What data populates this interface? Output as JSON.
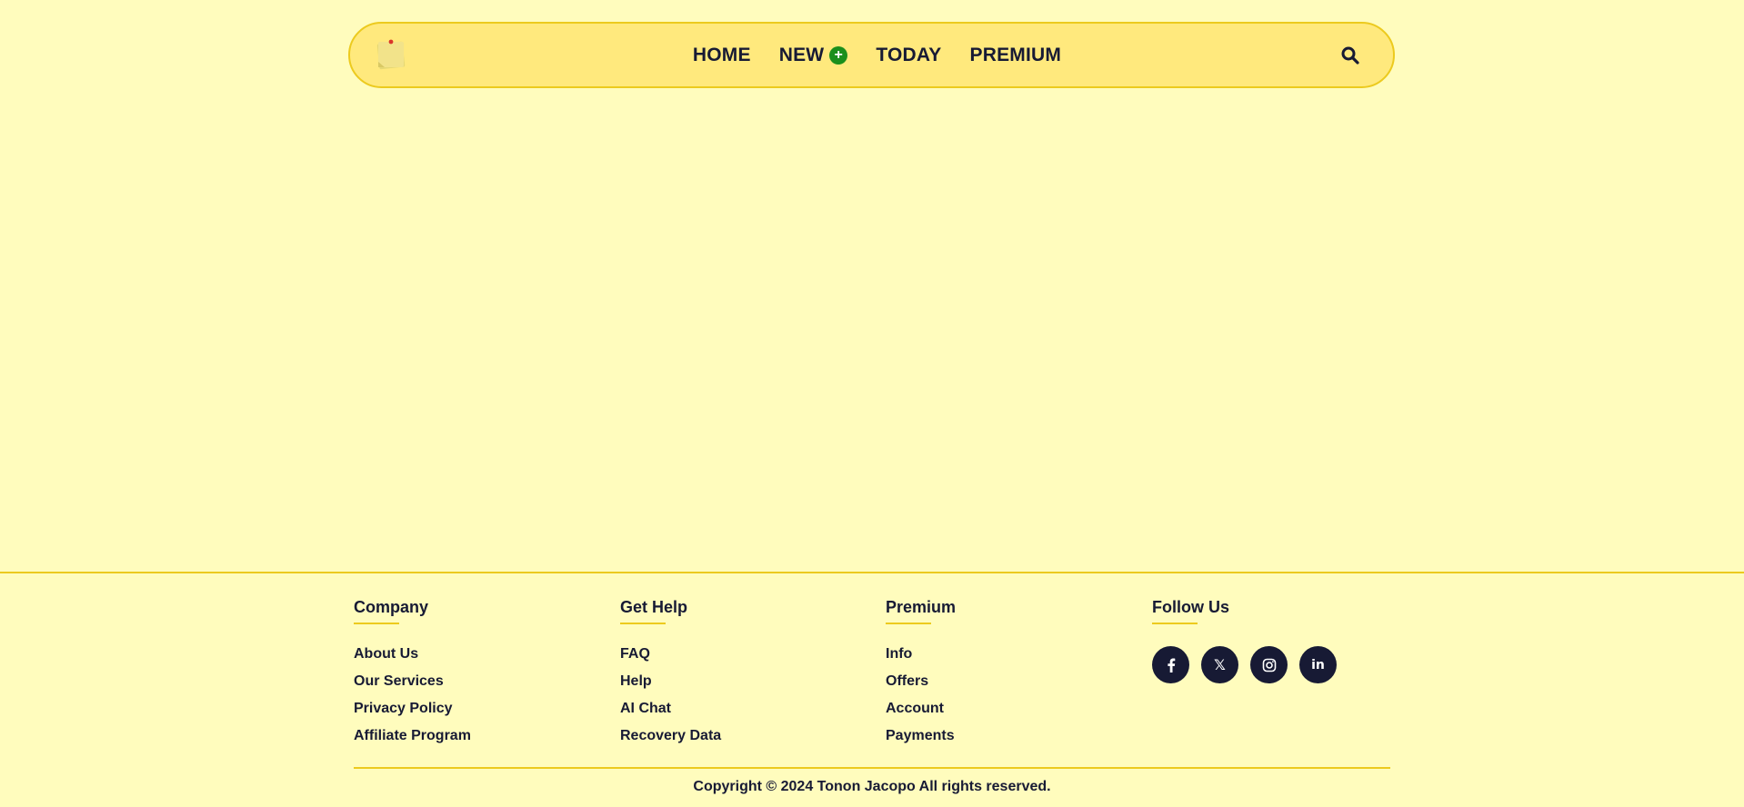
{
  "nav": {
    "links": [
      {
        "label": "HOME"
      },
      {
        "label": "NEW"
      },
      {
        "label": "TODAY"
      },
      {
        "label": "PREMIUM"
      }
    ],
    "new_badge": "+"
  },
  "footer": {
    "columns": [
      {
        "heading": "Company",
        "links": [
          "About Us",
          "Our Services",
          "Privacy Policy",
          "Affiliate Program"
        ]
      },
      {
        "heading": "Get Help",
        "links": [
          "FAQ",
          "Help",
          "AI Chat",
          "Recovery Data"
        ]
      },
      {
        "heading": "Premium",
        "links": [
          "Info",
          "Offers",
          "Account",
          "Payments"
        ]
      }
    ],
    "follow": {
      "heading": "Follow Us",
      "icons": [
        "facebook-icon",
        "x-twitter-icon",
        "instagram-icon",
        "linkedin-icon"
      ],
      "x_glyph": "𝕏",
      "linkedin_text": "in"
    },
    "copyright": "Copyright © 2024 Tonon Jacopo All rights reserved."
  },
  "colors": {
    "background": "#fffcbd",
    "navbar": "#ffe97d",
    "accent": "#ecca1e",
    "text": "#171a34",
    "new_badge": "#1a8f1c"
  }
}
